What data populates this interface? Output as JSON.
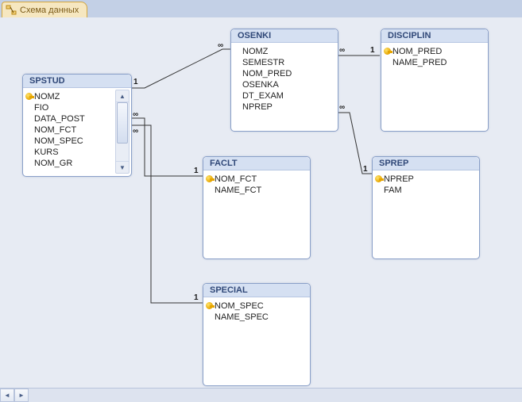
{
  "tab_title": "Схема данных",
  "tables": {
    "spstud": {
      "title": "SPSTUD",
      "fields": [
        "NOMZ",
        "FIO",
        "DATA_POST",
        "NOM_FCT",
        "NOM_SPEC",
        "KURS",
        "NOM_GR"
      ],
      "keys": [
        "NOMZ"
      ]
    },
    "osenki": {
      "title": "OSENKI",
      "fields": [
        "NOMZ",
        "SEMESTR",
        "NOM_PRED",
        "OSENKA",
        "DT_EXAM",
        "NPREP"
      ],
      "keys": []
    },
    "disciplin": {
      "title": "DISCIPLIN",
      "fields": [
        "NOM_PRED",
        "NAME_PRED"
      ],
      "keys": [
        "NOM_PRED"
      ]
    },
    "faclt": {
      "title": "FACLT",
      "fields": [
        "NOM_FCT",
        "NAME_FCT"
      ],
      "keys": [
        "NOM_FCT"
      ]
    },
    "sprep": {
      "title": "SPREP",
      "fields": [
        "NPREP",
        "FAM"
      ],
      "keys": [
        "NPREP"
      ]
    },
    "special": {
      "title": "SPECIAL",
      "fields": [
        "NOM_SPEC",
        "NAME_SPEC"
      ],
      "keys": [
        "NOM_SPEC"
      ]
    }
  },
  "relations": [
    {
      "from": "spstud",
      "to": "osenki",
      "from_card": "1",
      "to_card": "∞"
    },
    {
      "from": "spstud",
      "to": "faclt",
      "from_card": "∞",
      "to_card": "1"
    },
    {
      "from": "spstud",
      "to": "special",
      "from_card": "∞",
      "to_card": "1"
    },
    {
      "from": "osenki",
      "to": "disciplin",
      "from_card": "∞",
      "to_card": "1"
    },
    {
      "from": "osenki",
      "to": "sprep",
      "from_card": "∞",
      "to_card": "1"
    }
  ],
  "labels": {
    "one": "1",
    "many": "∞"
  }
}
